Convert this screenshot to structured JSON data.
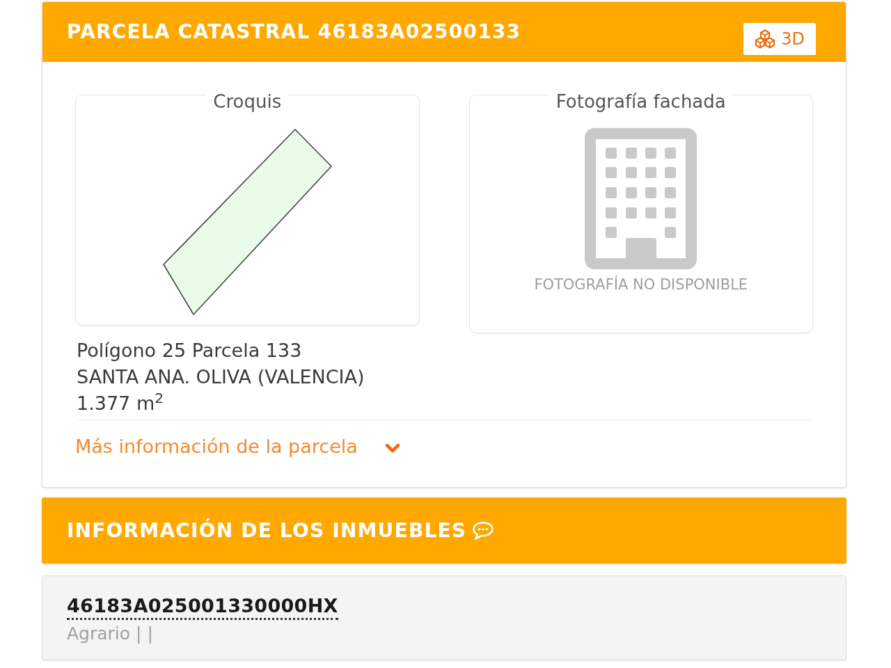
{
  "parcel_panel": {
    "title": "PARCELA CATASTRAL 46183A02500133",
    "view_3d_button": {
      "label": "3D"
    },
    "sketch": {
      "legend": "Croquis"
    },
    "facade_photo": {
      "legend": "Fotografía fachada",
      "message": "FOTOGRAFÍA NO DISPONIBLE"
    },
    "details": [
      "Polígono 25 Parcela 133",
      "SANTA ANA. OLIVA (VALENCIA)",
      "1.377 m$^{2}$"
    ],
    "more_info_link": {
      "label": "Más información de la parcela",
      "expanded": false
    }
  },
  "properties_panel": {
    "title": "INFORMACIÓN DE LOS INMUEBLES",
    "items": [
      {
        "reference": "46183A025001330000HX",
        "use": "Agrario | |"
      }
    ]
  }
}
